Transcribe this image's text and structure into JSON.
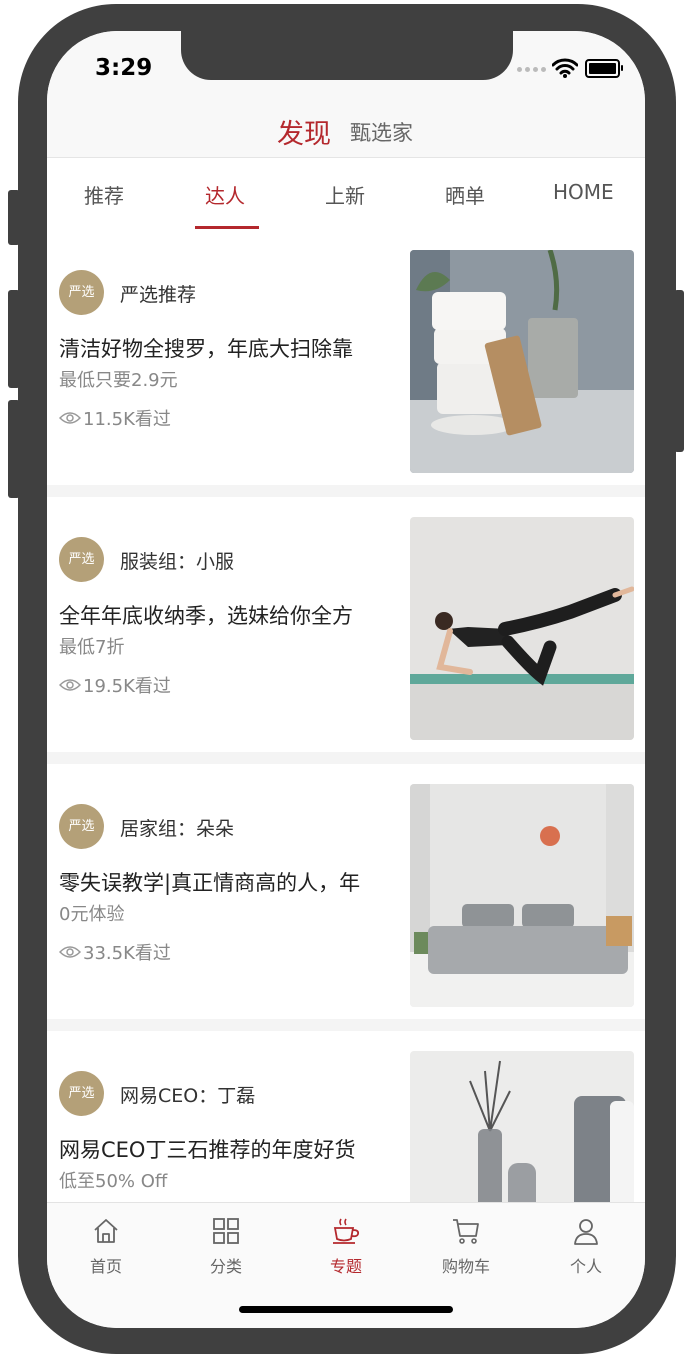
{
  "status": {
    "time": "3:29"
  },
  "header": {
    "title": "发现",
    "subtitle": "甄选家"
  },
  "tabs": [
    {
      "label": "推荐",
      "active": false
    },
    {
      "label": "达人",
      "active": true
    },
    {
      "label": "上新",
      "active": false
    },
    {
      "label": "晒单",
      "active": false
    },
    {
      "label": "HOME",
      "active": false
    }
  ],
  "avatar_text": "严选",
  "cards": [
    {
      "author": "严选推荐",
      "title": "清洁好物全搜罗，年底大扫除靠",
      "subtitle": "最低只要2.9元",
      "views": "11.5K看过"
    },
    {
      "author": "服装组：小服",
      "title": "全年年底收纳季，选妹给你全方",
      "subtitle": "最低7折",
      "views": "19.5K看过"
    },
    {
      "author": "居家组：朵朵",
      "title": "零失误教学|真正情商高的人，年",
      "subtitle": "0元体验",
      "views": "33.5K看过"
    },
    {
      "author": "网易CEO：丁磊",
      "title": "网易CEO丁三石推荐的年度好货",
      "subtitle": "低至50% Off",
      "views": ""
    }
  ],
  "tabbar": [
    {
      "label": "首页",
      "icon": "home-icon",
      "active": false
    },
    {
      "label": "分类",
      "icon": "grid-icon",
      "active": false
    },
    {
      "label": "专题",
      "icon": "coffee-cup-icon",
      "active": true
    },
    {
      "label": "购物车",
      "icon": "cart-icon",
      "active": false
    },
    {
      "label": "个人",
      "icon": "person-icon",
      "active": false
    }
  ],
  "colors": {
    "accent": "#b4282d",
    "avatar": "#b4a078",
    "phone_frame": "#404040"
  }
}
